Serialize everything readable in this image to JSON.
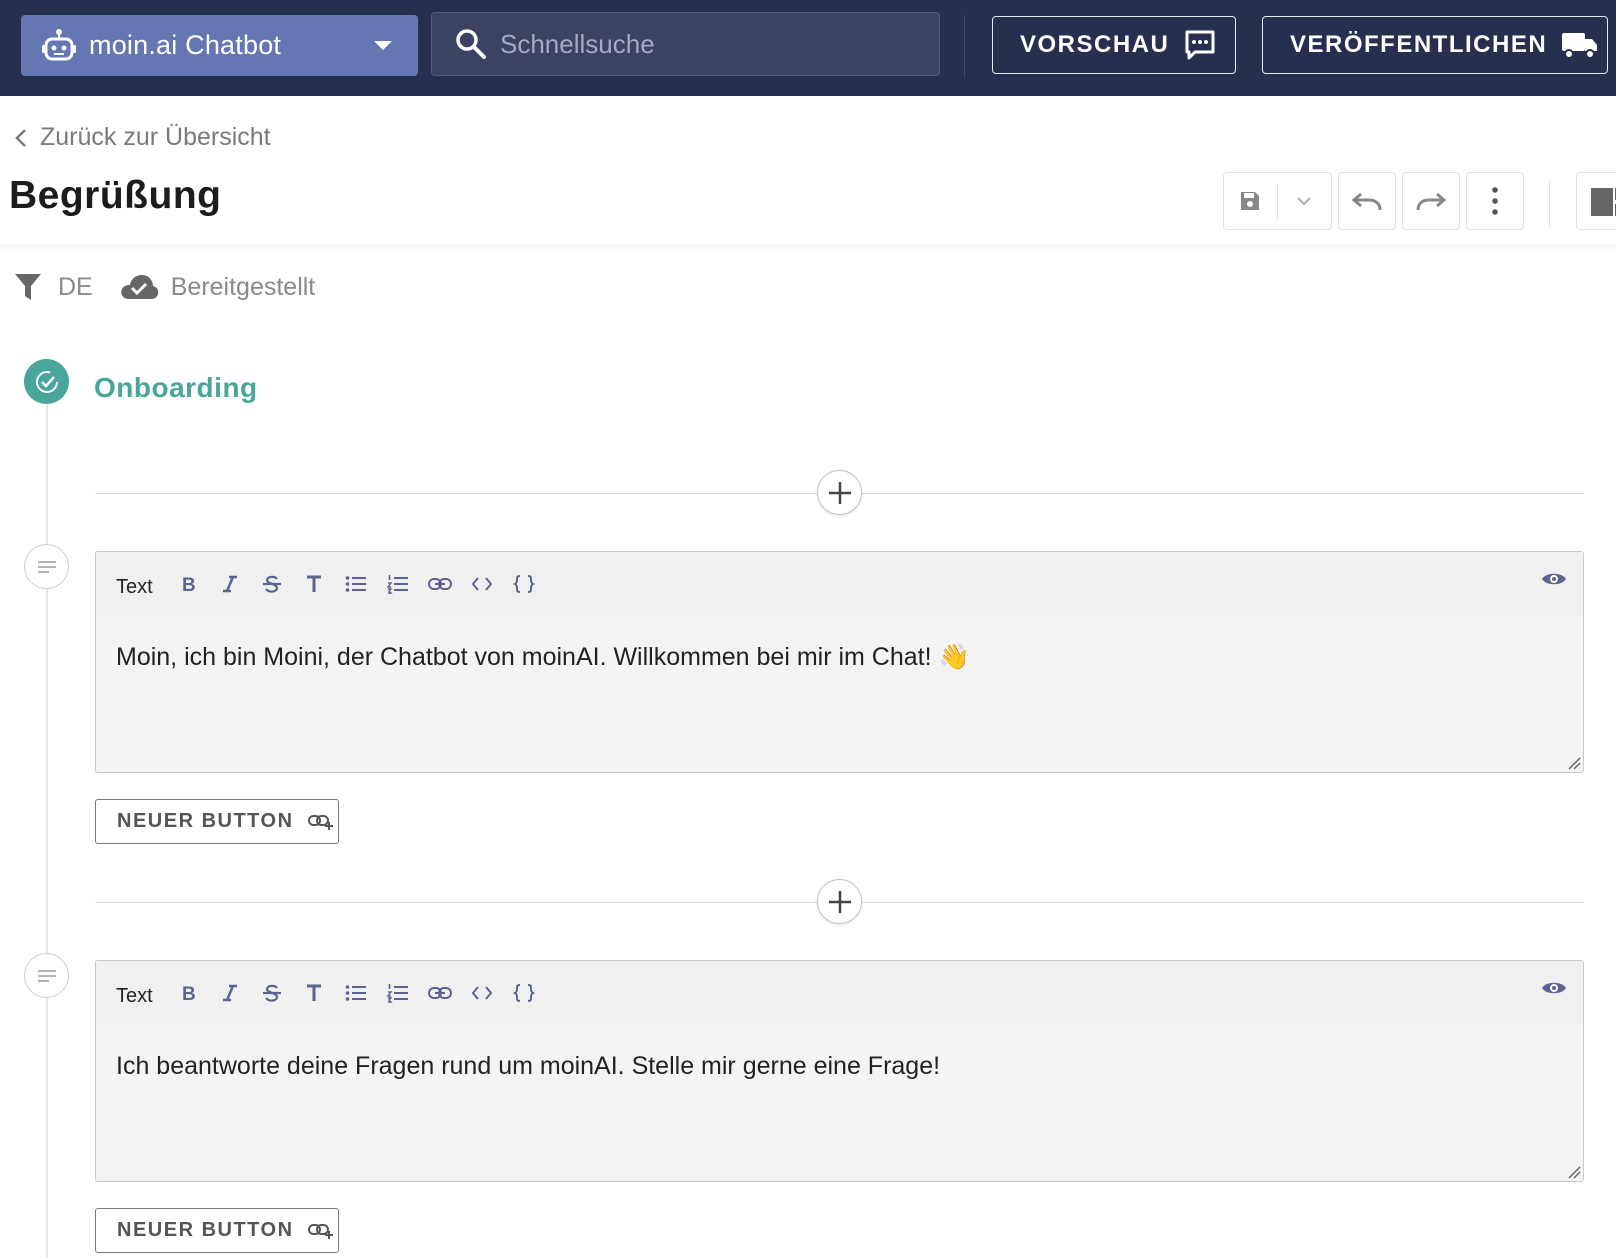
{
  "topbar": {
    "bot_name": "moin.ai Chatbot",
    "search_placeholder": "Schnellsuche",
    "preview_label": "VORSCHAU",
    "publish_label": "VERÖFFENTLICHEN"
  },
  "header": {
    "back_label": "Zurück zur Übersicht",
    "title": "Begrüßung"
  },
  "meta": {
    "language": "DE",
    "status": "Bereitgestellt"
  },
  "section": {
    "title": "Onboarding"
  },
  "editors": [
    {
      "type_label": "Text",
      "content": "Moin, ich bin Moini, der Chatbot von moinAI. Willkommen bei mir im Chat! 👋",
      "button_label": "NEUER BUTTON"
    },
    {
      "type_label": "Text",
      "content": "Ich beantworte deine Fragen rund um moinAI. Stelle mir gerne eine Frage!",
      "button_label": "NEUER BUTTON"
    }
  ],
  "colors": {
    "topbar_bg": "#272f4f",
    "bot_select_bg": "#6577b3",
    "accent_teal": "#4aa59a",
    "toolbar_icon": "#5b6491"
  },
  "icons": {
    "bot": "robot-icon",
    "search": "search-icon",
    "preview": "chat-bubble-icon",
    "publish": "truck-icon",
    "back": "chevron-left-icon",
    "save": "save-icon",
    "undo": "undo-icon",
    "redo": "redo-icon",
    "more": "more-vertical-icon",
    "filter": "filter-icon",
    "status": "cloud-check-icon",
    "section": "check-circle-icon",
    "add": "plus-icon",
    "text_node": "text-lines-icon",
    "preview_eye": "eye-icon",
    "new_button": "link-plus-icon"
  }
}
